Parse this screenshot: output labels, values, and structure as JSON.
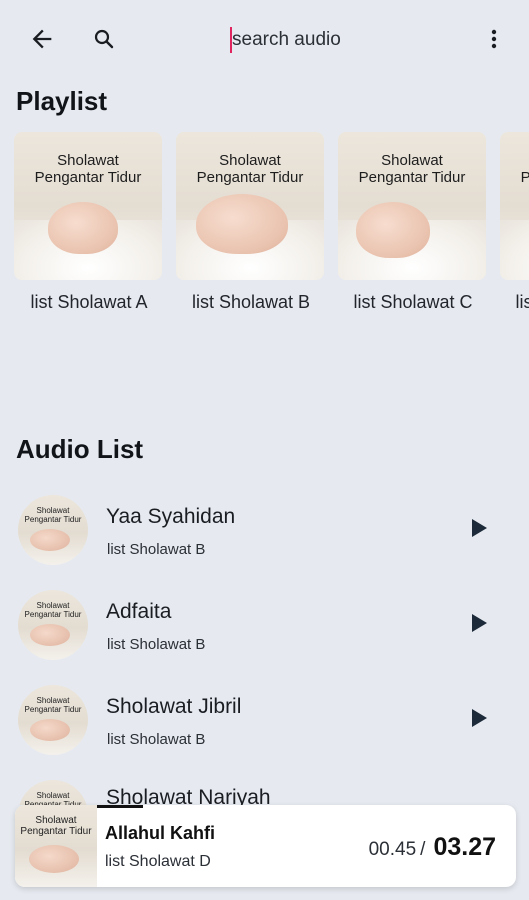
{
  "header": {
    "search_placeholder": "search audio",
    "icons": {
      "back": "arrow-left-icon",
      "search": "search-icon",
      "menu": "more-vertical-icon"
    }
  },
  "playlist": {
    "title": "Playlist",
    "cover_title_line1": "Sholawat",
    "cover_title_line2": "Pengantar Tidur",
    "items": [
      {
        "label": "list Sholawat A"
      },
      {
        "label": "list Sholawat B"
      },
      {
        "label": "list Sholawat C"
      },
      {
        "label": "list Sholawat D"
      }
    ]
  },
  "audio_list": {
    "title": "Audio List",
    "thumb_line1": "Sholawat",
    "thumb_line2": "Pengantar Tidur",
    "items": [
      {
        "title": "Yaa Syahidan",
        "playlist": "list Sholawat B"
      },
      {
        "title": "Adfaita",
        "playlist": "list Sholawat B"
      },
      {
        "title": "Sholawat Jibril",
        "playlist": "list Sholawat B"
      }
    ],
    "partial_item_title": "Sholawat Nariyah"
  },
  "player": {
    "title": "Allahul Kahfi",
    "playlist": "list Sholawat D",
    "current_time": "00.45",
    "separator": "/",
    "total_time": "03.27",
    "thumb_line1": "Sholawat",
    "thumb_line2": "Pengantar Tidur"
  },
  "colors": {
    "background": "#e6eaf0",
    "caret": "#e0245e",
    "text": "#111418"
  }
}
